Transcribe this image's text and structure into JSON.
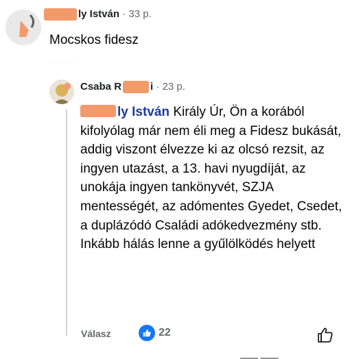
{
  "comment1": {
    "author_suffix": "ly István",
    "time": "33 p.",
    "text": "Mocskos fidesz"
  },
  "comment2": {
    "author_prefix": "Csaba R",
    "author_suffix": "i",
    "time": "23 p.",
    "mention_suffix": "ly István",
    "text": "Király Úr, Ön a korából kifolyólag már nem éli meg a Fidesz bukását, addig viszont élvezze ki az olcsó rezsit, az ingyen utazást, a 13. havi nyugdíját, az unokája ingyen tankönyvét, SZJA mentességét, az adómentes Gyedet, Csedet, a duplázódó Családi adókedvezmény stb. Inkább hálás lenne a gyűlölködés helyett"
  },
  "actions": {
    "reply_label": "Válasz",
    "reaction_count": "22"
  },
  "colors": {
    "redaction": "#f39a6b",
    "mention": "#1b3b9c",
    "like_blue": "#1877f2"
  }
}
